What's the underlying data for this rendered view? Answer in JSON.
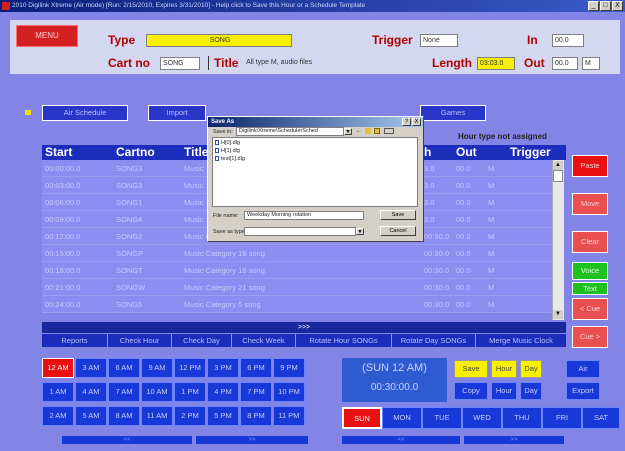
{
  "window": {
    "title": "2010 Digilink Xtreme (Air mode) [Run: 2/15/2010, Expires 3/31/2010] - Help click to Save this Hour or a Schedule Template",
    "controls": [
      "_",
      "□",
      "X"
    ]
  },
  "header": {
    "menu_label": "MENU",
    "type_label": "Type",
    "type_value": "SONG",
    "trigger_label": "Trigger",
    "trigger_value": "None",
    "in_label": "In",
    "in_value": "00.0",
    "cart_label": "Cart no",
    "cart_value": "SONG",
    "title_label": "Title",
    "title_value": "All type M, audio files",
    "length_label": "Length",
    "length_value": "03:03.0",
    "out_label": "Out",
    "out_value": "00.0",
    "out_extra": "M"
  },
  "toolbar": {
    "air_schedule": "Air Schedule",
    "import": "Import",
    "games": "Games"
  },
  "hour_note": "Hour type not assigned",
  "grid": {
    "columns": [
      "Start",
      "Cartno",
      "Title",
      "h",
      "Out",
      "Trigger"
    ],
    "rows": [
      {
        "start": "00:00:00.0",
        "cart": "SONG3",
        "title": "Music",
        "len": "3.0",
        "out": "00.0",
        "m": "M"
      },
      {
        "start": "00:03:00.0",
        "cart": "SONG3",
        "title": "Music",
        "len": "3.0",
        "out": "00.0",
        "m": "M"
      },
      {
        "start": "00:06:00.0",
        "cart": "SONG1",
        "title": "Music",
        "len": "3.0",
        "out": "00.0",
        "m": "M"
      },
      {
        "start": "00:09:00.0",
        "cart": "SONG4",
        "title": "Music",
        "len": "3.0",
        "out": "00.0",
        "m": "M"
      },
      {
        "start": "00:12:00.0",
        "cart": "SONG2",
        "title": "Music Category 1 song",
        "len": "00:30.0",
        "out": "00.0",
        "m": "M"
      },
      {
        "start": "00:15:00.0",
        "cart": "SONGP",
        "title": "Music Category 16 song",
        "len": "00:30.0",
        "out": "00.0",
        "m": "M"
      },
      {
        "start": "00:18:00.0",
        "cart": "SONGT",
        "title": "Music Category 19 song",
        "len": "00:30.0",
        "out": "00.0",
        "m": "M"
      },
      {
        "start": "00:21:00.0",
        "cart": "SONGW",
        "title": "Music Category 21 song",
        "len": "00:30.0",
        "out": "00.0",
        "m": "M"
      },
      {
        "start": "00:24:00.0",
        "cart": "SONG5",
        "title": "Music Category 5 song",
        "len": "00:30.0",
        "out": "00.0",
        "m": "M"
      }
    ],
    "more_label": ">>>"
  },
  "bottom_tabs": [
    "Reports",
    "Check Hour",
    "Check Day",
    "Check Week",
    "Rotate Hour SONGs",
    "Rotate Day SONGs",
    "Merge Music Clock"
  ],
  "side_buttons": {
    "paste": "Paste",
    "move": "Move",
    "clear": "Clear",
    "voice": "Voice",
    "text": "Text",
    "cue_prev": "< Cue",
    "cue_next": "Cue >"
  },
  "hours": {
    "row1": [
      "12 AM",
      "3 AM",
      "6 AM",
      "9 AM",
      "12 PM",
      "3 PM",
      "6 PM",
      "9 PM"
    ],
    "row2": [
      "1 AM",
      "4 AM",
      "7 AM",
      "10 AM",
      "1 PM",
      "4 PM",
      "7 PM",
      "10 PM"
    ],
    "row3": [
      "2 AM",
      "5 AM",
      "8 AM",
      "11 AM",
      "2 PM",
      "5 PM",
      "8 PM",
      "11 PM"
    ]
  },
  "current": {
    "label": "(SUN 12 AM)",
    "time": "00:30:00.0"
  },
  "schedule_buttons": {
    "save": "Save",
    "hour": "Hour",
    "day": "Day",
    "copy": "Copy",
    "hour2": "Hour",
    "day2": "Day",
    "air": "Air",
    "export": "Export"
  },
  "days": [
    "SUN",
    "MON",
    "TUE",
    "WED",
    "THU",
    "FRI",
    "SAT"
  ],
  "footer": [
    "<<",
    ">>",
    "<<",
    ">>"
  ],
  "dialog": {
    "title": "Save As",
    "controls": [
      "?",
      "X"
    ],
    "save_in_label": "Save in:",
    "save_in_value": "Digilink\\Xtreme\\SchedulerSched",
    "files": [
      "H[0].dlg",
      "H[1].dlg",
      "test[1].dlg"
    ],
    "file_name_label": "File name:",
    "file_name_value": "Weekday Morning rotation",
    "save_type_label": "Save as type:",
    "save_type_value": "",
    "save_button": "Save",
    "cancel_button": "Cancel",
    "toolbar_icons": [
      "back-icon",
      "up-folder-icon",
      "new-folder-icon",
      "view-menu-icon"
    ]
  },
  "colors": {
    "background": "#8385e6",
    "header_bar": "#1c2dbb",
    "highlight": "#e81010",
    "accent_yellow": "#f8f000"
  }
}
